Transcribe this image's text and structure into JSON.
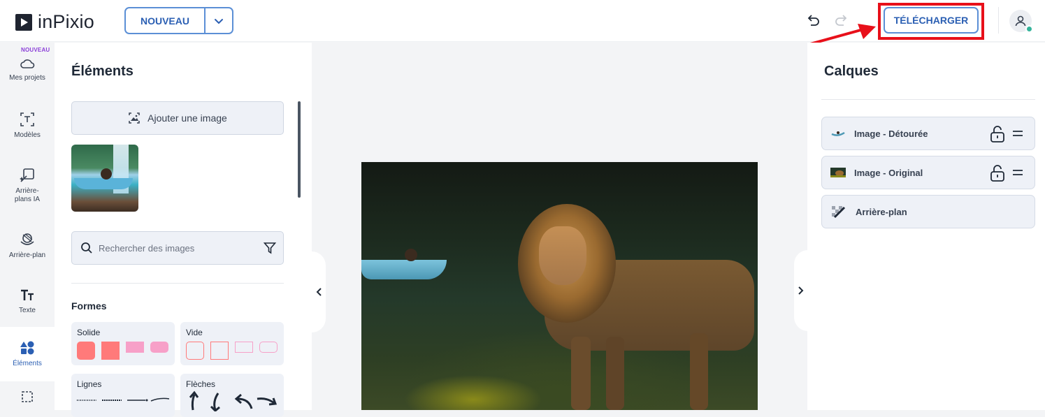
{
  "header": {
    "logo_text": "inPixio",
    "new_label": "NOUVEAU",
    "download_label": "TÉLÉCHARGER"
  },
  "leftnav": {
    "badge": "NOUVEAU",
    "items": [
      {
        "label": "Mes projets",
        "icon": "cloud-icon"
      },
      {
        "label": "Modèles",
        "icon": "template-icon"
      },
      {
        "label": "Arrière-plans IA",
        "icon": "ai-background-icon"
      },
      {
        "label": "Arrière-plan",
        "icon": "background-icon"
      },
      {
        "label": "Texte",
        "icon": "text-icon"
      },
      {
        "label": "Éléments",
        "icon": "shapes-icon",
        "active": true
      }
    ]
  },
  "elements": {
    "title": "Éléments",
    "add_image_label": "Ajouter une image",
    "search_placeholder": "Rechercher des images",
    "shapes_title": "Formes",
    "cards": {
      "solid": "Solide",
      "empty": "Vide",
      "lines": "Lignes",
      "arrows": "Flèches"
    }
  },
  "layers": {
    "title": "Calques",
    "items": [
      {
        "label": "Image - Détourée"
      },
      {
        "label": "Image - Original"
      },
      {
        "label": "Arrière-plan"
      }
    ]
  },
  "colors": {
    "accent": "#2b5fb3",
    "highlight": "#e8101a",
    "shape_solid": "#ff7a7a",
    "shape_pink": "#f7a0c8",
    "avatar_status": "#34b39a"
  }
}
